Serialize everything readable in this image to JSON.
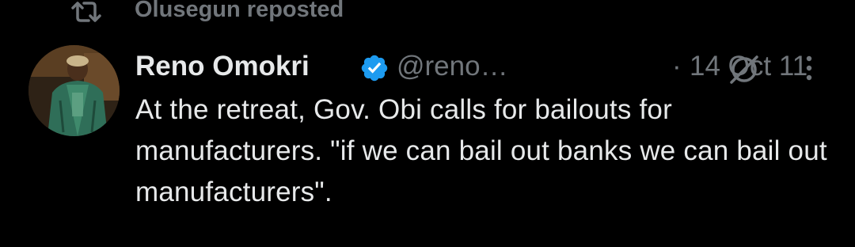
{
  "repost": {
    "label": "Olusegun reposted",
    "icon": "repost-icon"
  },
  "tweet": {
    "author_name": "Reno Omokri",
    "handle": "@reno…",
    "separator": "·",
    "date": "14 Oct 11",
    "verified_icon": "verified-badge-icon",
    "text": "At the retreat, Gov. Obi calls for bailouts for manufacturers. \"if we can bail out banks we can bail out manufacturers\"."
  },
  "colors": {
    "background": "#000000",
    "primary_text": "#e7e9ea",
    "secondary_text": "#71767b",
    "verified": "#1d9bf0"
  }
}
